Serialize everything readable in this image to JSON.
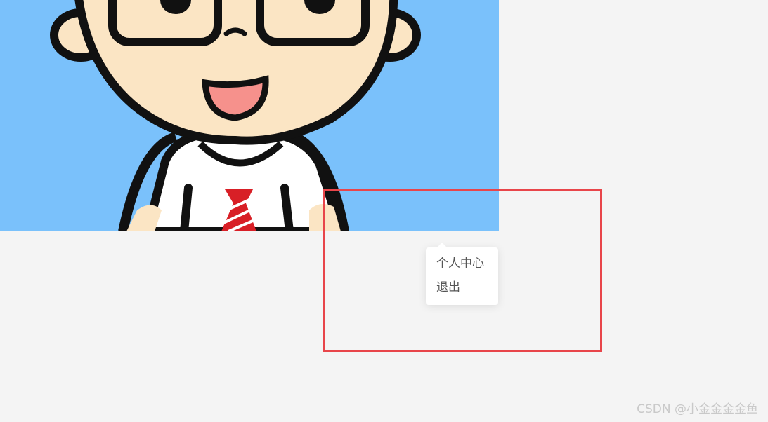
{
  "avatar": {
    "name": "user-avatar",
    "background_color": "#7ac1fb"
  },
  "dropdown": {
    "items": [
      {
        "label": "个人中心"
      },
      {
        "label": "退出"
      }
    ]
  },
  "annotation": {
    "highlight_color": "#e8454a"
  },
  "watermark": {
    "text": "CSDN @小金金金金鱼"
  }
}
